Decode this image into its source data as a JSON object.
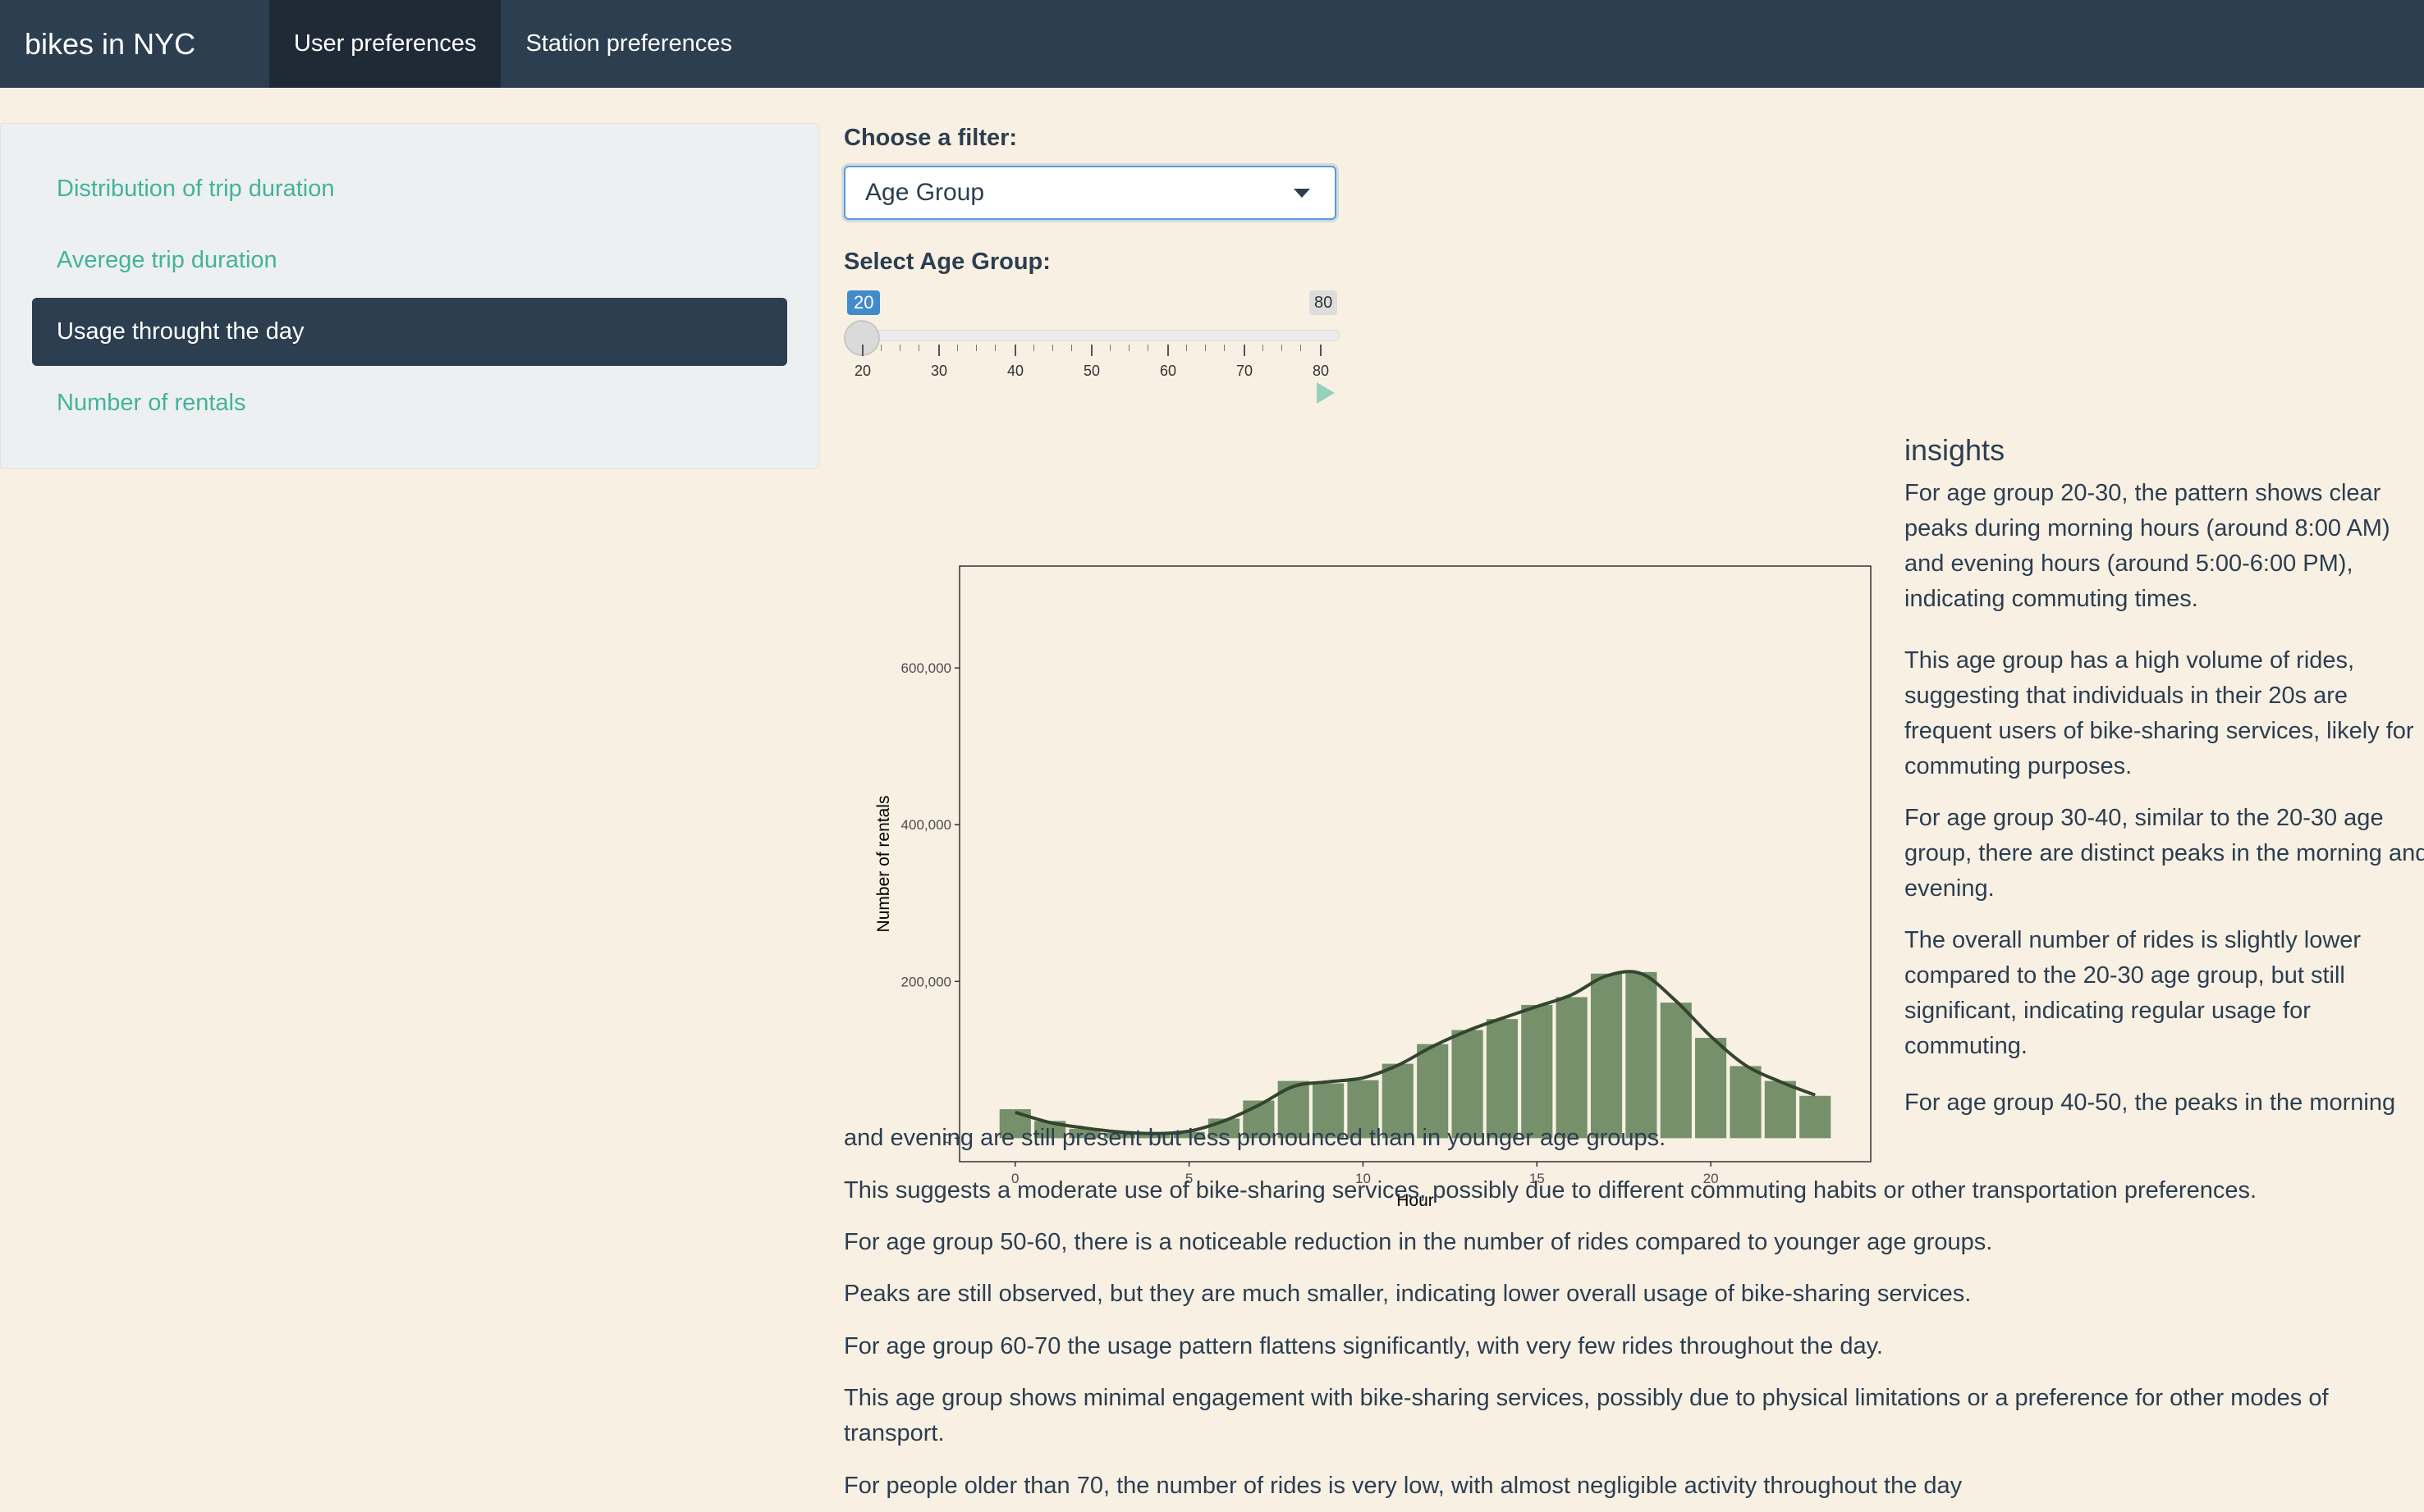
{
  "navbar": {
    "brand": "bikes in NYC",
    "tabs": [
      {
        "label": "User preferences",
        "active": true
      },
      {
        "label": "Station preferences",
        "active": false
      }
    ]
  },
  "sidebar": {
    "items": [
      {
        "label": "Distribution of trip duration",
        "active": false
      },
      {
        "label": "Averege trip duration",
        "active": false
      },
      {
        "label": "Usage throught the day",
        "active": true
      },
      {
        "label": "Number of rentals",
        "active": false
      }
    ]
  },
  "filter": {
    "label": "Choose a filter:",
    "selected": "Age Group"
  },
  "slider": {
    "label": "Select Age Group:",
    "min_value": "20",
    "max_value": "80",
    "ticks": [
      "20",
      "30",
      "40",
      "50",
      "60",
      "70",
      "80"
    ]
  },
  "chart_data": {
    "type": "bar",
    "xlabel": "Hour",
    "ylabel": "Number of rentals",
    "x": [
      0,
      1,
      2,
      3,
      4,
      5,
      6,
      7,
      8,
      9,
      10,
      11,
      12,
      13,
      14,
      15,
      16,
      17,
      18,
      19,
      20,
      21,
      22,
      23
    ],
    "values": [
      37000,
      22000,
      12000,
      7000,
      6000,
      8000,
      25000,
      48000,
      73000,
      70000,
      74000,
      95000,
      120000,
      138000,
      152000,
      170000,
      180000,
      210000,
      212000,
      173000,
      128000,
      92000,
      73000,
      54000
    ],
    "smooth_line": [
      33000,
      20000,
      13000,
      8000,
      6000,
      9000,
      22000,
      42000,
      66000,
      72000,
      77000,
      93000,
      117000,
      137000,
      153000,
      168000,
      183000,
      207000,
      210000,
      175000,
      130000,
      93000,
      72000,
      55000
    ],
    "yticks": [
      "0",
      "200,000",
      "400,000",
      "600,000"
    ],
    "ytick_values": [
      0,
      200000,
      400000,
      600000
    ],
    "xticks": [
      "0",
      "5",
      "10",
      "15",
      "20"
    ],
    "xtick_values": [
      0,
      5,
      10,
      15,
      20
    ],
    "ylim": [
      -30000,
      730000
    ],
    "xlim": [
      -1.6,
      24.6
    ],
    "bar_color": "#76906b",
    "line_color": "#34452f"
  },
  "insights": {
    "title": "insights",
    "paragraphs": [
      [
        "For age group 20-30, the pattern shows clear",
        "peaks during morning hours (around 8:00 AM)",
        "and evening hours (around 5:00-6:00 PM),",
        "indicating commuting times."
      ],
      [
        "This age group has a high volume of rides,",
        "suggesting that individuals in their 20s are",
        "frequent users of bike-sharing services, likely for",
        "commuting purposes."
      ],
      [
        "For age group 30-40, similar to the 20-30 age",
        "group, there are distinct peaks in the morning and",
        "evening."
      ],
      [
        "The overall number of rides is slightly lower",
        "compared to the 20-30 age group, but still",
        "significant, indicating regular usage for",
        "commuting."
      ],
      [
        "For age group 40-50, the peaks in the morning"
      ]
    ],
    "wide": [
      "and evening are still present but less pronounced than in younger age groups.",
      "This suggests a moderate use of bike-sharing services, possibly due to different commuting habits or other transportation preferences.",
      "For age group 50-60, there is a noticeable reduction in the number of rides compared to younger age groups.",
      "Peaks are still observed, but they are much smaller, indicating lower overall usage of bike-sharing services.",
      "For age group 60-70 the usage pattern flattens significantly, with very few rides throughout the day.",
      "This age group shows minimal engagement with bike-sharing services, possibly due to physical limitations or a preference for other modes of",
      "transport.",
      "For people older than 70, the number of rides is very low, with almost negligible activity throughout the day"
    ]
  }
}
